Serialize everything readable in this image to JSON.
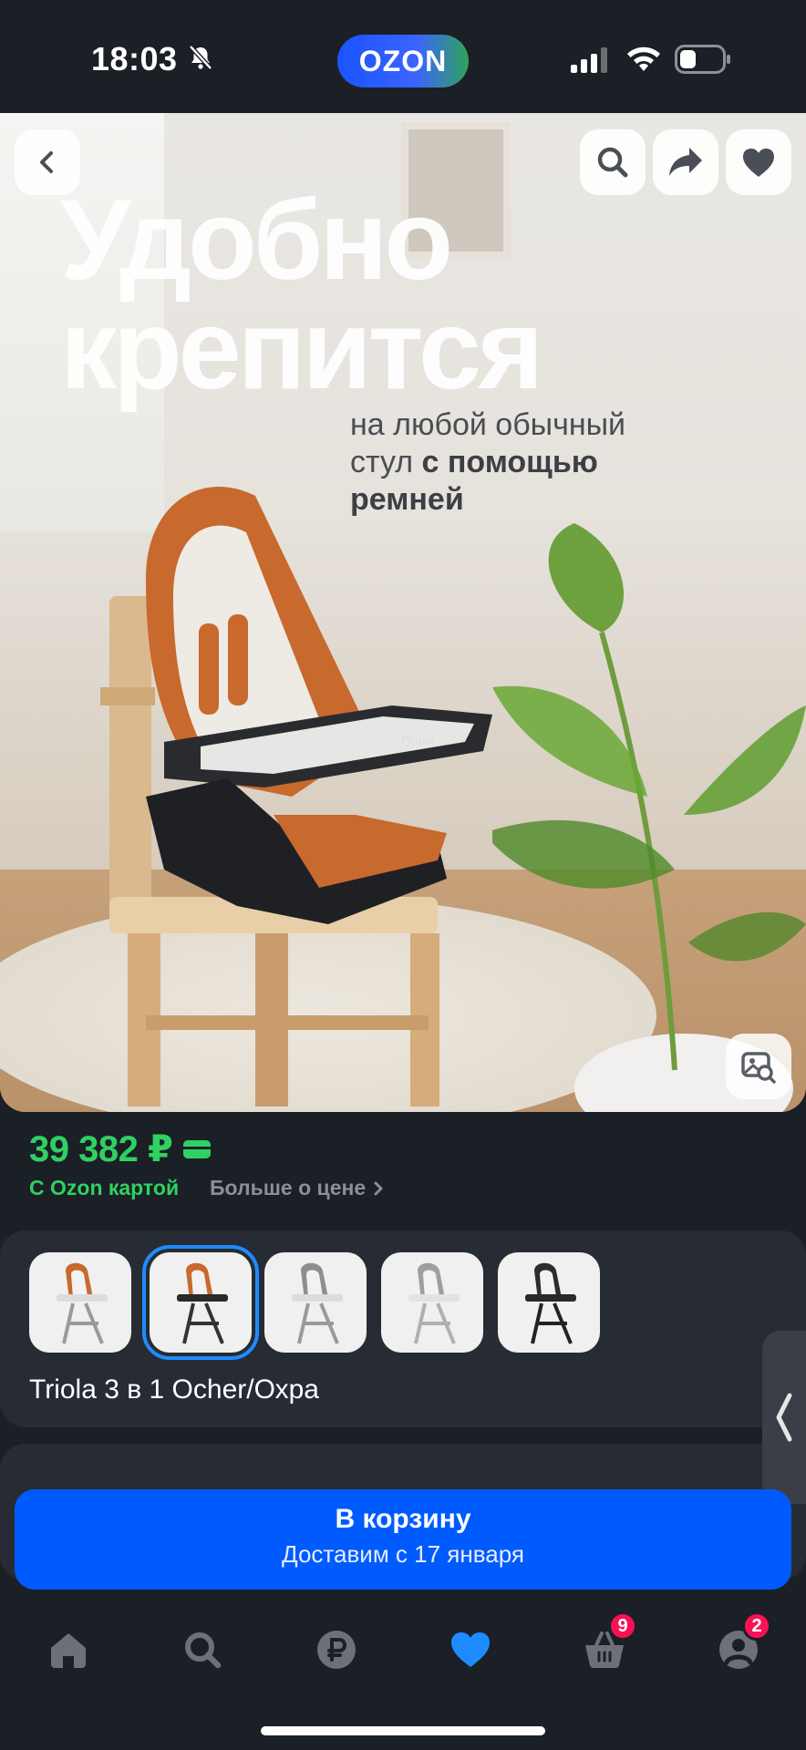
{
  "status_bar": {
    "time": "18:03",
    "brand": "OZON"
  },
  "hero": {
    "headline_line1": "Удобно",
    "headline_line2": "крепится",
    "sub_line1": "на любой обычный",
    "sub_line2_a": "стул ",
    "sub_line2_b": "с помощью",
    "sub_line3": "ремней",
    "chair_brand": "Pituso"
  },
  "price": {
    "value": "39 382 ₽",
    "caption": "С Ozon картой",
    "more_label": "Больше о цене"
  },
  "variants": {
    "selected_index": 1,
    "name": "Triola 3 в 1 Ocher/Охра"
  },
  "cart": {
    "title": "В корзину",
    "subtitle": "Доставим с 17 января"
  },
  "tab_bar": {
    "items": [
      {
        "icon": "home-icon"
      },
      {
        "icon": "search-icon"
      },
      {
        "icon": "ruble-icon"
      },
      {
        "icon": "heart-icon",
        "active": true
      },
      {
        "icon": "basket-icon",
        "badge": "9"
      },
      {
        "icon": "profile-icon",
        "badge": "2"
      }
    ]
  },
  "colors": {
    "accent": "#005bff",
    "price_green": "#2fd162",
    "badge": "#f91155",
    "active_tab": "#1e8cff",
    "background": "#1b1f26"
  }
}
